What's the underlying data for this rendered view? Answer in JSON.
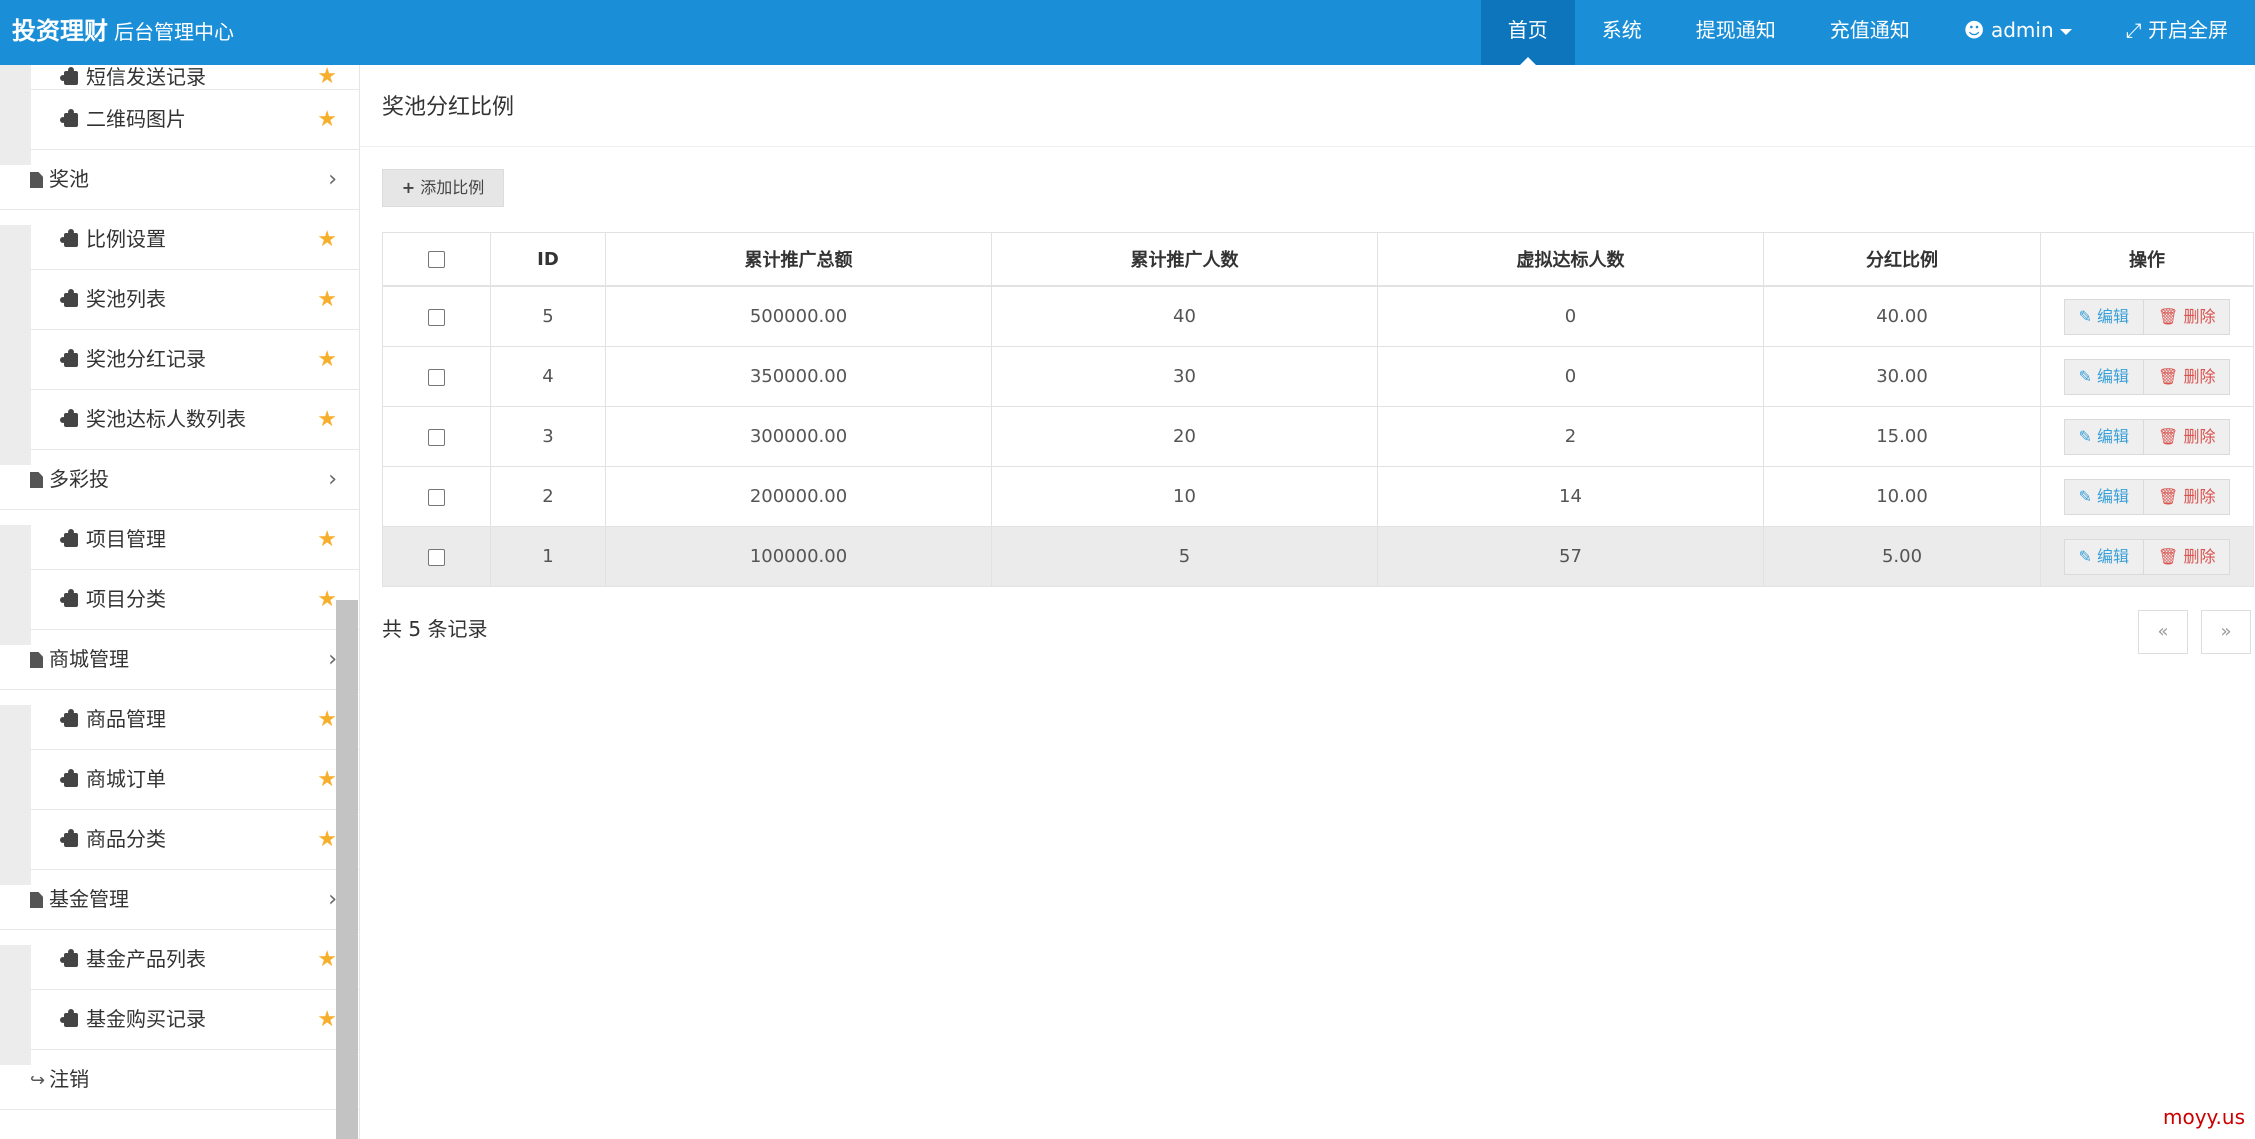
{
  "header": {
    "brand_main": "投资理财",
    "brand_sub": "后台管理中心",
    "nav": [
      {
        "label": "首页",
        "active": true
      },
      {
        "label": "系统"
      },
      {
        "label": "提现通知"
      },
      {
        "label": "充值通知"
      },
      {
        "label": "admin"
      },
      {
        "label": "开启全屏"
      }
    ]
  },
  "sidebar": {
    "items": [
      {
        "label": "短信发送记录"
      },
      {
        "label": "二维码图片"
      },
      {
        "label": "奖池"
      },
      {
        "label": "比例设置"
      },
      {
        "label": "奖池列表"
      },
      {
        "label": "奖池分红记录"
      },
      {
        "label": "奖池达标人数列表"
      },
      {
        "label": "多彩投"
      },
      {
        "label": "项目管理"
      },
      {
        "label": "项目分类"
      },
      {
        "label": "商城管理"
      },
      {
        "label": "商品管理"
      },
      {
        "label": "商城订单"
      },
      {
        "label": "商品分类"
      },
      {
        "label": "基金管理"
      },
      {
        "label": "基金产品列表"
      },
      {
        "label": "基金购买记录"
      },
      {
        "label": "注销"
      }
    ]
  },
  "main": {
    "title": "奖池分红比例",
    "add_button": "添加比例",
    "columns": [
      "ID",
      "累计推广总额",
      "累计推广人数",
      "虚拟达标人数",
      "分红比例",
      "操作"
    ],
    "rows": [
      {
        "id": "5",
        "total": "500000.00",
        "people": "40",
        "virtual": "0",
        "ratio": "40.00"
      },
      {
        "id": "4",
        "total": "350000.00",
        "people": "30",
        "virtual": "0",
        "ratio": "30.00"
      },
      {
        "id": "3",
        "total": "300000.00",
        "people": "20",
        "virtual": "2",
        "ratio": "15.00"
      },
      {
        "id": "2",
        "total": "200000.00",
        "people": "10",
        "virtual": "14",
        "ratio": "10.00"
      },
      {
        "id": "1",
        "total": "100000.00",
        "people": "5",
        "virtual": "57",
        "ratio": "5.00"
      }
    ],
    "edit_label": "编辑",
    "delete_label": "删除",
    "record_count": "共 5 条记录",
    "pager_prev": "«",
    "pager_next": "»"
  },
  "watermark": "moyy.us",
  "colors": {
    "header": "#1a8fd8",
    "header_active": "#0d75bc",
    "star": "#f6ae2d",
    "edit": "#3aa0d8",
    "delete": "#d9534f"
  }
}
